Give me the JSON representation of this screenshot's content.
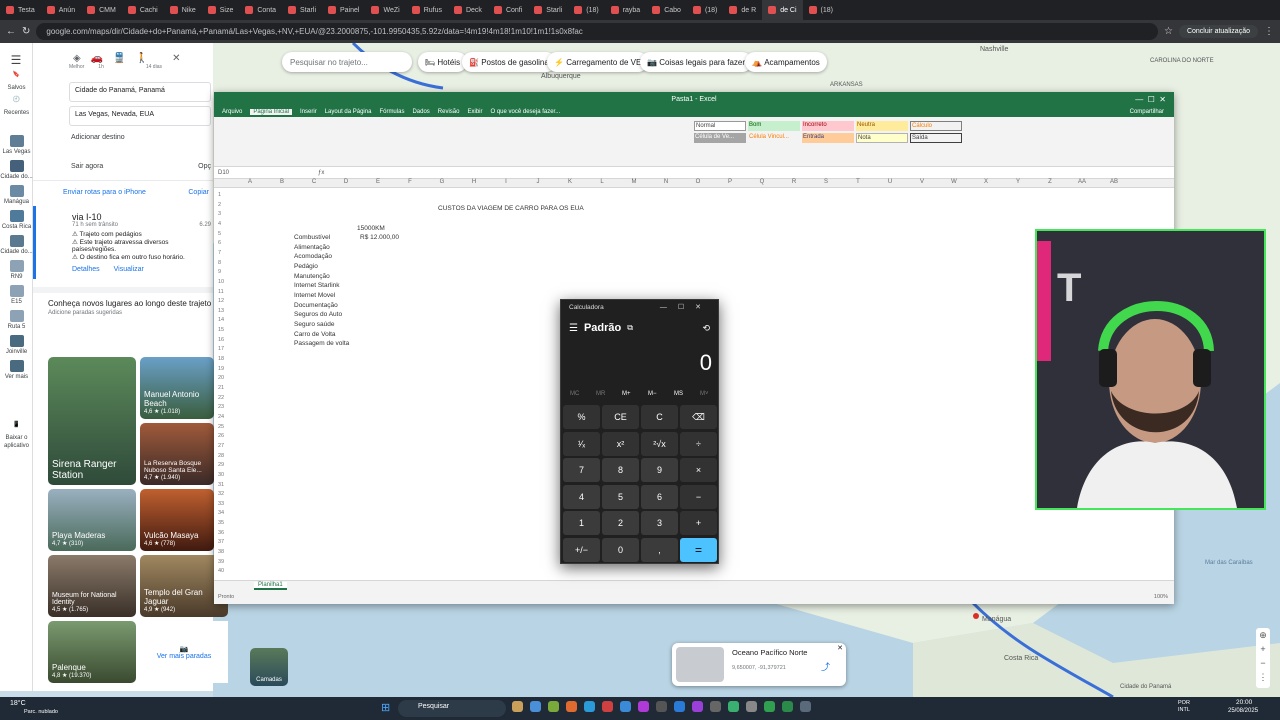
{
  "browser": {
    "tabs": [
      "Testa",
      "Anún",
      "CMM",
      "Cachi",
      "Nike",
      "Size",
      "Conta",
      "Starli",
      "Painel",
      "WeZi",
      "Rufus",
      "Deck",
      "Confi",
      "Starli",
      "(18)",
      "rayba",
      "Cabo",
      "(18)",
      "de R",
      "de Ci",
      "(18)"
    ],
    "url": "google.com/maps/dir/Cidade+do+Panamá,+Panamá/Las+Vegas,+NV,+EUA/@23.2000875,-101.9950435,5.92z/data=!4m19!4m18!1m10!1m1!1s0x8fac",
    "update_label": "Concluir atualização"
  },
  "maps": {
    "modes": [
      "Melhor",
      "1h",
      "",
      "14 dias"
    ],
    "origin": "Cidade do Panamá, Panamá",
    "destination": "Las Vegas, Nevada, EUA",
    "add_destination": "Adicionar destino",
    "depart": "Sair agora",
    "options": "Opç",
    "send_label": "Enviar rotas para o iPhone",
    "copy_label": "Copiar",
    "route_name": "via I-10",
    "route_time": "71 h sem trânsito",
    "route_dist": "6.29",
    "warnings": [
      "Trajeto com pedágios",
      "Este trajeto atravessa diversos países/regiões.",
      "O destino fica em outro fuso horário."
    ],
    "details": "Detalhes",
    "view": "Visualizar",
    "discover": "Conheça novos lugares ao longo deste trajeto",
    "suggested": "Adicione paradas sugeridas",
    "places": [
      {
        "name": "Sirena Ranger Station",
        "rating": ""
      },
      {
        "name": "Manuel Antonio Beach",
        "rating": "4,6 ★ (1.018)"
      },
      {
        "name": "La Reserva Bosque Nuboso Santa Ele...",
        "rating": "4,7 ★ (1.940)"
      },
      {
        "name": "Playa Maderas",
        "rating": "4,7 ★ (310)"
      },
      {
        "name": "Vulcão Masaya",
        "rating": "4,6 ★ (778)"
      },
      {
        "name": "Museum for National Identity",
        "rating": "4,5 ★ (1.765)"
      },
      {
        "name": "Templo del Gran Jaguar",
        "rating": "4,9 ★ (942)"
      },
      {
        "name": "Palenque",
        "rating": "4,8 ★ (19.370)"
      }
    ],
    "more_stops": "Ver mais paradas",
    "search_placeholder": "Pesquisar no trajeto...",
    "chips": [
      "Hotéis",
      "Postos de gasolina",
      "Carregamento de VE",
      "Coisas legais para fazer",
      "Acampamentos"
    ],
    "left_nav": [
      "Salvos",
      "Recentes",
      "Las Vegas",
      "Cidade do...",
      "Manágua",
      "Costa Rica",
      "Cidade do...",
      "RN9",
      "E15",
      "Ruta 5",
      "Joinville",
      "Ver mais",
      "Baixar o aplicativo"
    ],
    "layers": "Camadas",
    "map_labels": [
      "Nashville",
      "CAROLINA DO NORTE",
      "Albuquerque",
      "ARKANSAS",
      "Manágua",
      "Costa Rica",
      "Mar das Caraíbas",
      "Cidade do Panamá"
    ],
    "card_title": "Oceano Pacífico Norte",
    "card_coords": "9,650007, -91,379721"
  },
  "excel": {
    "title": "Pasta1 - Excel",
    "ribbon_tabs": [
      "Arquivo",
      "Página Inicial",
      "Inserir",
      "Layout da Página",
      "Fórmulas",
      "Dados",
      "Revisão",
      "Exibir",
      "O que você deseja fazer..."
    ],
    "share": "Compartilhar",
    "styles": [
      "Normal",
      "Bom",
      "Incorreto",
      "Neutra",
      "Cálculo",
      "Célula de Ve...",
      "Célula Vincul...",
      "Entrada",
      "Nota",
      "Saída"
    ],
    "name_box": "D10",
    "columns": [
      "A",
      "B",
      "C",
      "D",
      "E",
      "F",
      "G",
      "H",
      "I",
      "J",
      "K",
      "L",
      "M",
      "N",
      "O",
      "P",
      "Q",
      "R",
      "S",
      "T",
      "U",
      "V",
      "W",
      "X",
      "Y",
      "Z",
      "AA",
      "AB"
    ],
    "heading": "CUSTOS DA VIAGEM DE CARRO PARA OS EUA",
    "km": "15000KM",
    "fuel_value": "R$ 12.000,00",
    "items": [
      "Combustível",
      "Alimentação",
      "Acomodação",
      "Pedágio",
      "Manutenção",
      "Internet Starlink",
      "Internet Movel",
      "Documentação",
      "Seguros do Auto",
      "Seguro saúde",
      "Carro de Volta",
      "Passagem de volta"
    ],
    "sheet": "Planilha1",
    "status": "Pronto",
    "zoom": "100%"
  },
  "calculator": {
    "title": "Calculadora",
    "mode": "Padrão",
    "display": "0",
    "memory": [
      "MC",
      "MR",
      "M+",
      "M−",
      "MS",
      "M˅"
    ],
    "keys": [
      "%",
      "CE",
      "C",
      "⌫",
      "¹⁄ₓ",
      "x²",
      "²√x",
      "÷",
      "7",
      "8",
      "9",
      "×",
      "4",
      "5",
      "6",
      "−",
      "1",
      "2",
      "3",
      "+",
      "+/−",
      "0",
      ",",
      "="
    ]
  },
  "taskbar": {
    "weather": "18°C",
    "weather_desc": "Parc. nublado",
    "search": "Pesquisar",
    "lang": "POR INTL",
    "time": "20:00",
    "date": "25/08/2025"
  }
}
